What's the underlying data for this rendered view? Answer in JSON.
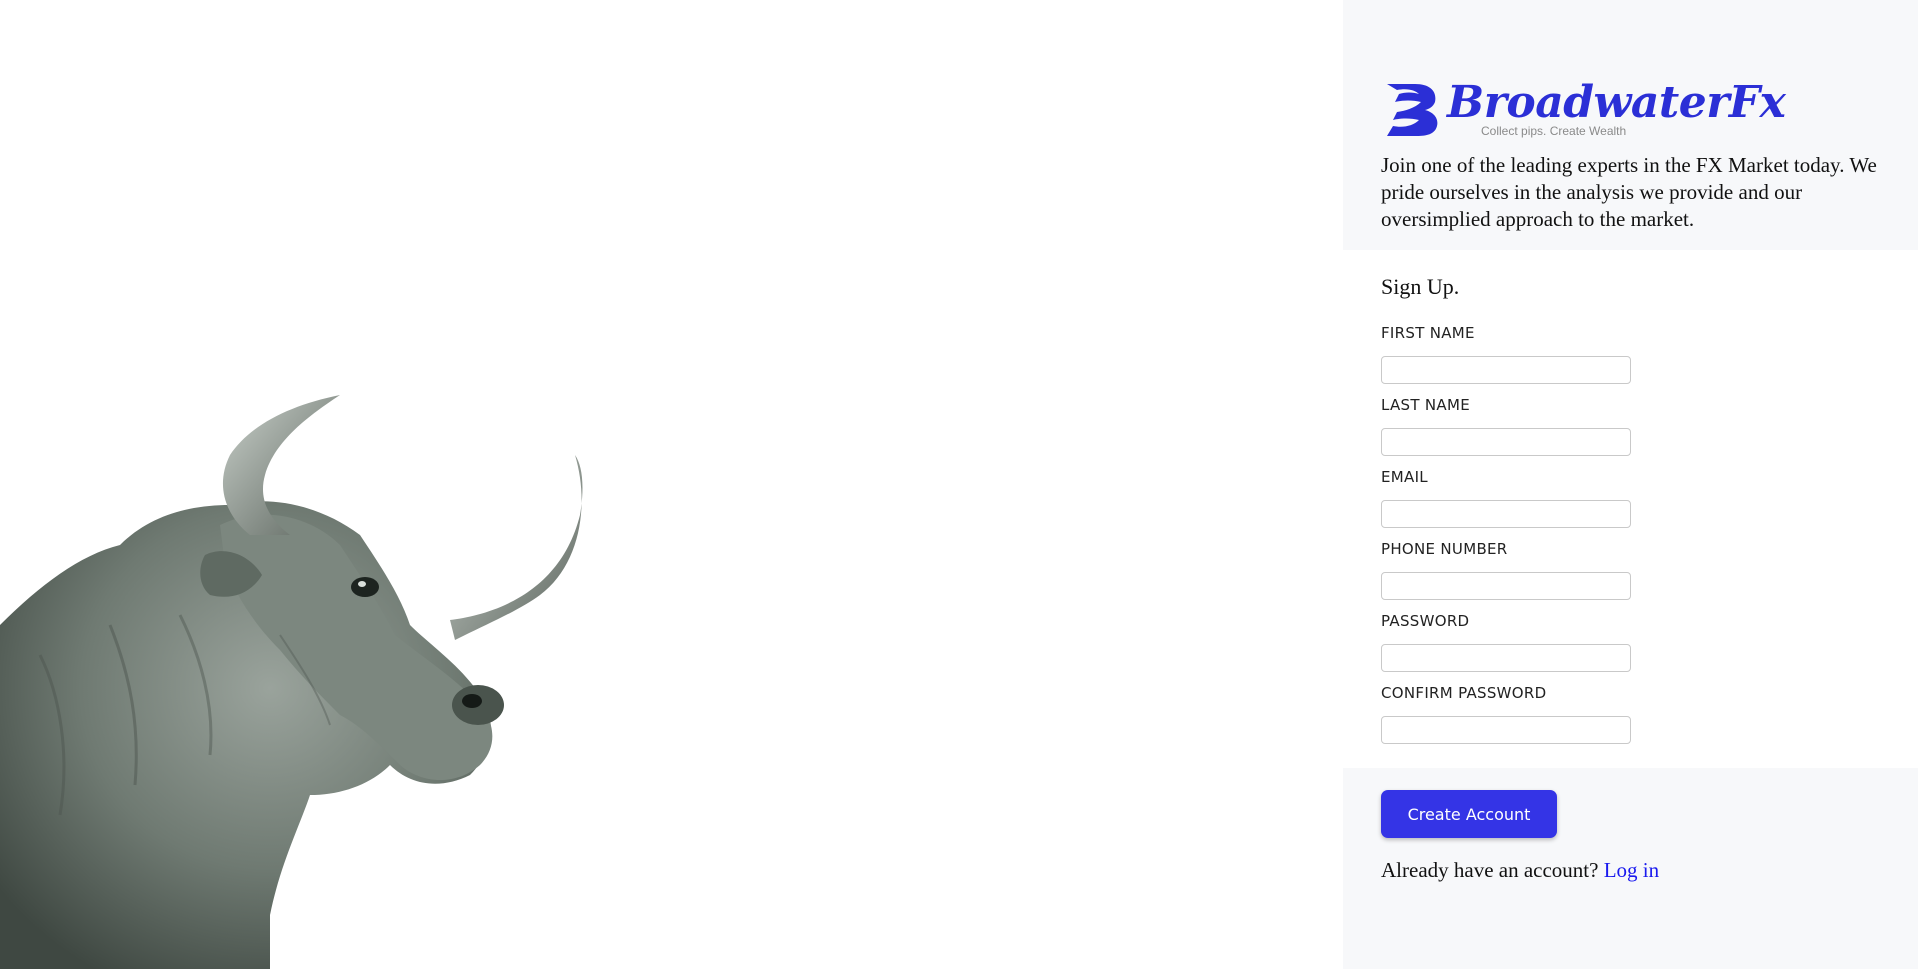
{
  "brand": {
    "name": "BroadwaterFx",
    "tagline": "Collect pips. Create Wealth",
    "color": "#2b2fd6"
  },
  "intro": "Join one of the leading experts in the FX Market today. We pride ourselves in the analysis we provide and our oversimplied approach to the market.",
  "form": {
    "title": "Sign Up.",
    "fields": [
      {
        "label": "FIRST NAME",
        "value": ""
      },
      {
        "label": "LAST NAME",
        "value": ""
      },
      {
        "label": "EMAIL",
        "value": ""
      },
      {
        "label": "PHONE NUMBER",
        "value": ""
      },
      {
        "label": "PASSWORD",
        "value": ""
      },
      {
        "label": "CONFIRM PASSWORD",
        "value": ""
      }
    ],
    "submit_label": "Create Account",
    "button_color": "#3434e6"
  },
  "login": {
    "prompt": "Already have an account?",
    "link_label": "Log in",
    "link_color": "#1a1aee"
  },
  "hero": {
    "image": "bull-illustration"
  }
}
